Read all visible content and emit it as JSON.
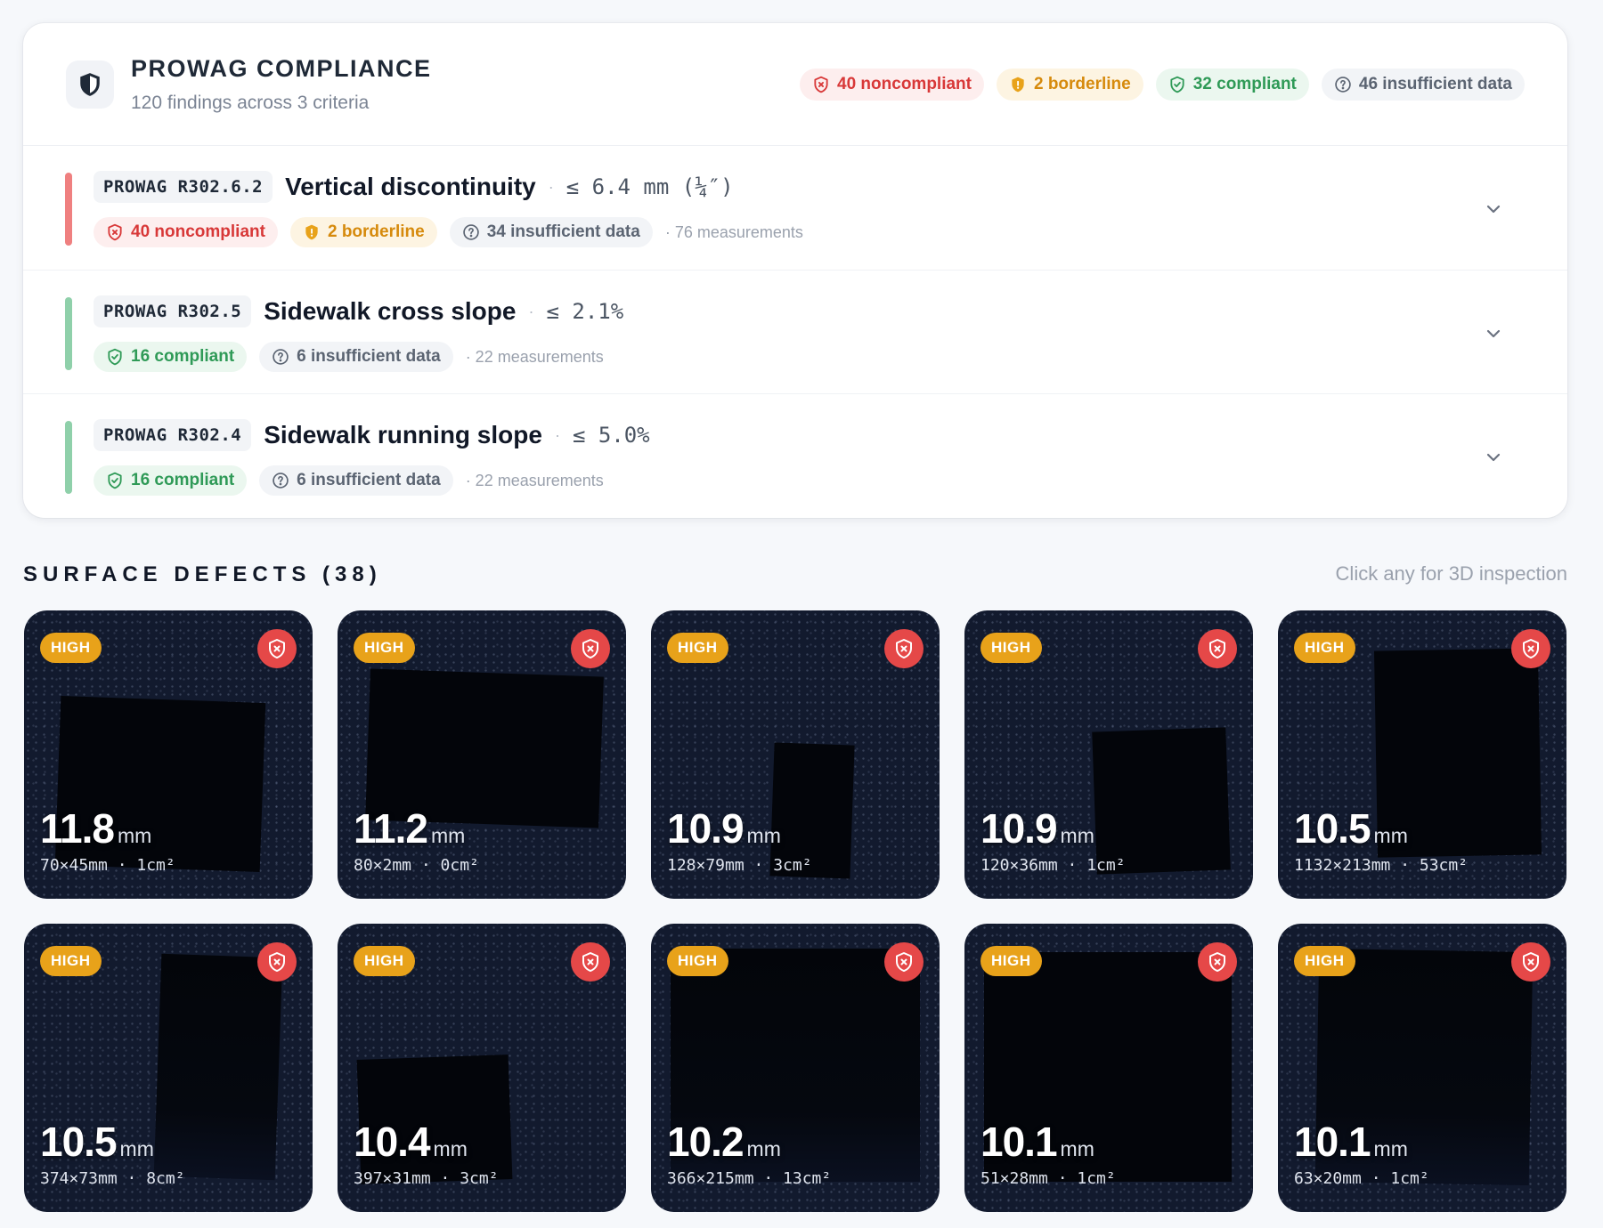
{
  "header": {
    "title": "PROWAG COMPLIANCE",
    "subtitle": "120 findings across 3 criteria",
    "summary": {
      "noncompliant": "40 noncompliant",
      "borderline": "2 borderline",
      "compliant": "32 compliant",
      "insufficient": "46 insufficient data"
    }
  },
  "colors": {
    "noncompliant": "#d83838",
    "borderline": "#d68a0c",
    "compliant": "#2f9a57",
    "severity_high": "#e8a21a",
    "tile_bg": "#121a2e"
  },
  "criteria": [
    {
      "code": "PROWAG R302.6.2",
      "name": "Vertical discontinuity",
      "threshold": "≤ 6.4 mm (¼″)",
      "status": "noncompliant",
      "noncompliant": "40 noncompliant",
      "borderline": "2 borderline",
      "insufficient": "34 insufficient data",
      "measurements": "· 76 measurements"
    },
    {
      "code": "PROWAG R302.5",
      "name": "Sidewalk cross slope",
      "threshold": "≤ 2.1%",
      "status": "compliant",
      "compliant": "16 compliant",
      "insufficient": "6 insufficient data",
      "measurements": "· 22 measurements"
    },
    {
      "code": "PROWAG R302.4",
      "name": "Sidewalk running slope",
      "threshold": "≤ 5.0%",
      "status": "compliant",
      "compliant": "16 compliant",
      "insufficient": "6 insufficient data",
      "measurements": "· 22 measurements"
    }
  ],
  "defects": {
    "title": "SURFACE DEFECTS (38)",
    "hint": "Click any for 3D inspection",
    "unit": "mm",
    "items": [
      {
        "severity": "HIGH",
        "depth": "11.8",
        "dims": "70×45mm · 1cm²"
      },
      {
        "severity": "HIGH",
        "depth": "11.2",
        "dims": "80×2mm · 0cm²"
      },
      {
        "severity": "HIGH",
        "depth": "10.9",
        "dims": "128×79mm · 3cm²"
      },
      {
        "severity": "HIGH",
        "depth": "10.9",
        "dims": "120×36mm · 1cm²"
      },
      {
        "severity": "HIGH",
        "depth": "10.5",
        "dims": "1132×213mm · 53cm²"
      },
      {
        "severity": "HIGH",
        "depth": "10.5",
        "dims": "374×73mm · 8cm²"
      },
      {
        "severity": "HIGH",
        "depth": "10.4",
        "dims": "397×31mm · 3cm²"
      },
      {
        "severity": "HIGH",
        "depth": "10.2",
        "dims": "366×215mm · 13cm²"
      },
      {
        "severity": "HIGH",
        "depth": "10.1",
        "dims": "51×28mm · 1cm²"
      },
      {
        "severity": "HIGH",
        "depth": "10.1",
        "dims": "63×20mm · 1cm²"
      }
    ]
  }
}
